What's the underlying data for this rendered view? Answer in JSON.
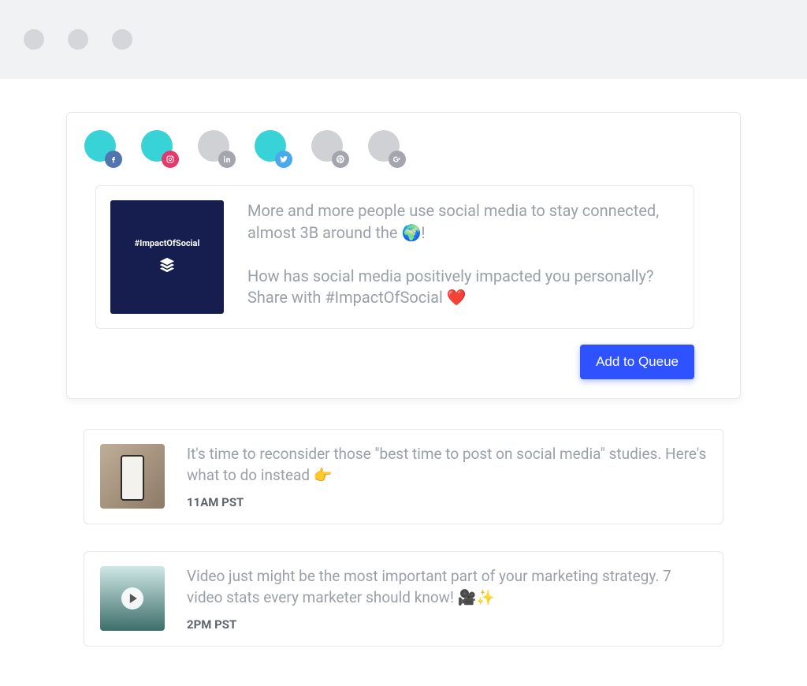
{
  "accounts": [
    {
      "name": "facebook",
      "active": true,
      "badge_class": "fb"
    },
    {
      "name": "instagram",
      "active": true,
      "badge_class": "ig"
    },
    {
      "name": "linkedin",
      "active": false,
      "badge_class": "li"
    },
    {
      "name": "twitter",
      "active": true,
      "badge_class": "tw"
    },
    {
      "name": "pinterest",
      "active": false,
      "badge_class": "pi"
    },
    {
      "name": "googleplus",
      "active": false,
      "badge_class": "gp"
    }
  ],
  "composer": {
    "thumb_label": "#ImpactOfSocial",
    "text": "More and more people use social media to stay connected, almost 3B around the 🌍!\n\nHow has social media positively impacted you personally? Share with #ImpactOfSocial ❤️",
    "action_label": "Add to Queue"
  },
  "queue": [
    {
      "text": "It's time to reconsider those \"best time to post on social media\" studies. Here's what to do instead 👉",
      "time": "11AM PST",
      "thumb": "phone"
    },
    {
      "text": "Video just might be the most important part of your marketing strategy. 7 video stats every marketer should know! 🎥✨",
      "time": "2PM PST",
      "thumb": "video"
    }
  ]
}
